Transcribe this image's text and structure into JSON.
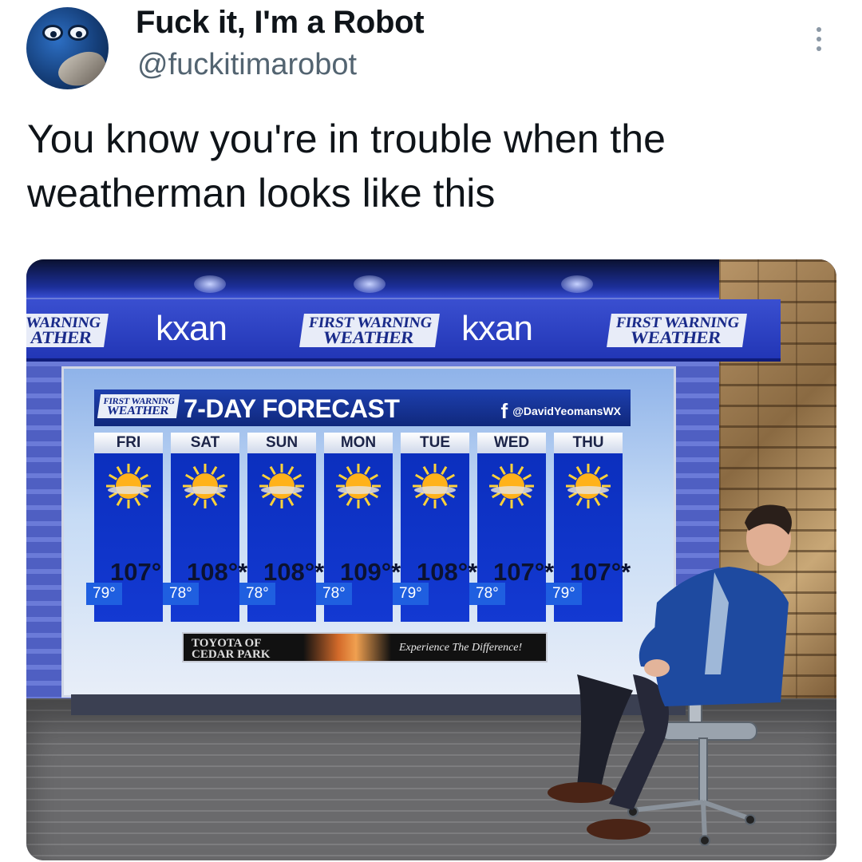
{
  "tweet": {
    "display_name": "Fuck it, I'm a Robot",
    "handle": "@fuckitimarobot",
    "text": "You know you're in trouble when the weatherman looks like this"
  },
  "media": {
    "banner": {
      "first_warning_small": "FIRST WARNING",
      "first_warning_big": "WEATHER",
      "partial_small": "WARNING",
      "partial_big": "ATHER",
      "station_logo": "kxan"
    },
    "forecast": {
      "logo_small": "FIRST WARNING",
      "logo_big": "WEATHER",
      "title": "7-DAY FORECAST",
      "social": "@DavidYeomansWX",
      "days": [
        {
          "name": "FRI",
          "high": "107°",
          "low": "79°"
        },
        {
          "name": "SAT",
          "high": "108°*",
          "low": "78°"
        },
        {
          "name": "SUN",
          "high": "108°*",
          "low": "78°"
        },
        {
          "name": "MON",
          "high": "109°*",
          "low": "78°"
        },
        {
          "name": "TUE",
          "high": "108°*",
          "low": "79°"
        },
        {
          "name": "WED",
          "high": "107°*",
          "low": "78°"
        },
        {
          "name": "THU",
          "high": "107°*",
          "low": "79°"
        }
      ],
      "sponsor_line1": "TOYOTA OF",
      "sponsor_line2": "CEDAR PARK",
      "sponsor_tagline": "Experience The Difference!"
    }
  },
  "colors": {
    "forecast_column": "#1339d2",
    "banner": "#2236b6",
    "handle_gray": "#536471"
  }
}
